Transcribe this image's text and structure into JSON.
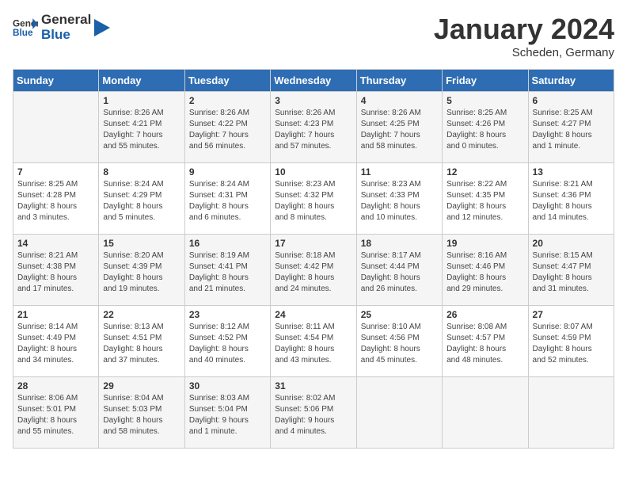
{
  "logo": {
    "line1": "General",
    "line2": "Blue"
  },
  "title": "January 2024",
  "location": "Scheden, Germany",
  "days_of_week": [
    "Sunday",
    "Monday",
    "Tuesday",
    "Wednesday",
    "Thursday",
    "Friday",
    "Saturday"
  ],
  "weeks": [
    [
      {
        "day": "",
        "content": ""
      },
      {
        "day": "1",
        "content": "Sunrise: 8:26 AM\nSunset: 4:21 PM\nDaylight: 7 hours\nand 55 minutes."
      },
      {
        "day": "2",
        "content": "Sunrise: 8:26 AM\nSunset: 4:22 PM\nDaylight: 7 hours\nand 56 minutes."
      },
      {
        "day": "3",
        "content": "Sunrise: 8:26 AM\nSunset: 4:23 PM\nDaylight: 7 hours\nand 57 minutes."
      },
      {
        "day": "4",
        "content": "Sunrise: 8:26 AM\nSunset: 4:25 PM\nDaylight: 7 hours\nand 58 minutes."
      },
      {
        "day": "5",
        "content": "Sunrise: 8:25 AM\nSunset: 4:26 PM\nDaylight: 8 hours\nand 0 minutes."
      },
      {
        "day": "6",
        "content": "Sunrise: 8:25 AM\nSunset: 4:27 PM\nDaylight: 8 hours\nand 1 minute."
      }
    ],
    [
      {
        "day": "7",
        "content": "Sunrise: 8:25 AM\nSunset: 4:28 PM\nDaylight: 8 hours\nand 3 minutes."
      },
      {
        "day": "8",
        "content": "Sunrise: 8:24 AM\nSunset: 4:29 PM\nDaylight: 8 hours\nand 5 minutes."
      },
      {
        "day": "9",
        "content": "Sunrise: 8:24 AM\nSunset: 4:31 PM\nDaylight: 8 hours\nand 6 minutes."
      },
      {
        "day": "10",
        "content": "Sunrise: 8:23 AM\nSunset: 4:32 PM\nDaylight: 8 hours\nand 8 minutes."
      },
      {
        "day": "11",
        "content": "Sunrise: 8:23 AM\nSunset: 4:33 PM\nDaylight: 8 hours\nand 10 minutes."
      },
      {
        "day": "12",
        "content": "Sunrise: 8:22 AM\nSunset: 4:35 PM\nDaylight: 8 hours\nand 12 minutes."
      },
      {
        "day": "13",
        "content": "Sunrise: 8:21 AM\nSunset: 4:36 PM\nDaylight: 8 hours\nand 14 minutes."
      }
    ],
    [
      {
        "day": "14",
        "content": "Sunrise: 8:21 AM\nSunset: 4:38 PM\nDaylight: 8 hours\nand 17 minutes."
      },
      {
        "day": "15",
        "content": "Sunrise: 8:20 AM\nSunset: 4:39 PM\nDaylight: 8 hours\nand 19 minutes."
      },
      {
        "day": "16",
        "content": "Sunrise: 8:19 AM\nSunset: 4:41 PM\nDaylight: 8 hours\nand 21 minutes."
      },
      {
        "day": "17",
        "content": "Sunrise: 8:18 AM\nSunset: 4:42 PM\nDaylight: 8 hours\nand 24 minutes."
      },
      {
        "day": "18",
        "content": "Sunrise: 8:17 AM\nSunset: 4:44 PM\nDaylight: 8 hours\nand 26 minutes."
      },
      {
        "day": "19",
        "content": "Sunrise: 8:16 AM\nSunset: 4:46 PM\nDaylight: 8 hours\nand 29 minutes."
      },
      {
        "day": "20",
        "content": "Sunrise: 8:15 AM\nSunset: 4:47 PM\nDaylight: 8 hours\nand 31 minutes."
      }
    ],
    [
      {
        "day": "21",
        "content": "Sunrise: 8:14 AM\nSunset: 4:49 PM\nDaylight: 8 hours\nand 34 minutes."
      },
      {
        "day": "22",
        "content": "Sunrise: 8:13 AM\nSunset: 4:51 PM\nDaylight: 8 hours\nand 37 minutes."
      },
      {
        "day": "23",
        "content": "Sunrise: 8:12 AM\nSunset: 4:52 PM\nDaylight: 8 hours\nand 40 minutes."
      },
      {
        "day": "24",
        "content": "Sunrise: 8:11 AM\nSunset: 4:54 PM\nDaylight: 8 hours\nand 43 minutes."
      },
      {
        "day": "25",
        "content": "Sunrise: 8:10 AM\nSunset: 4:56 PM\nDaylight: 8 hours\nand 45 minutes."
      },
      {
        "day": "26",
        "content": "Sunrise: 8:08 AM\nSunset: 4:57 PM\nDaylight: 8 hours\nand 48 minutes."
      },
      {
        "day": "27",
        "content": "Sunrise: 8:07 AM\nSunset: 4:59 PM\nDaylight: 8 hours\nand 52 minutes."
      }
    ],
    [
      {
        "day": "28",
        "content": "Sunrise: 8:06 AM\nSunset: 5:01 PM\nDaylight: 8 hours\nand 55 minutes."
      },
      {
        "day": "29",
        "content": "Sunrise: 8:04 AM\nSunset: 5:03 PM\nDaylight: 8 hours\nand 58 minutes."
      },
      {
        "day": "30",
        "content": "Sunrise: 8:03 AM\nSunset: 5:04 PM\nDaylight: 9 hours\nand 1 minute."
      },
      {
        "day": "31",
        "content": "Sunrise: 8:02 AM\nSunset: 5:06 PM\nDaylight: 9 hours\nand 4 minutes."
      },
      {
        "day": "",
        "content": ""
      },
      {
        "day": "",
        "content": ""
      },
      {
        "day": "",
        "content": ""
      }
    ]
  ]
}
